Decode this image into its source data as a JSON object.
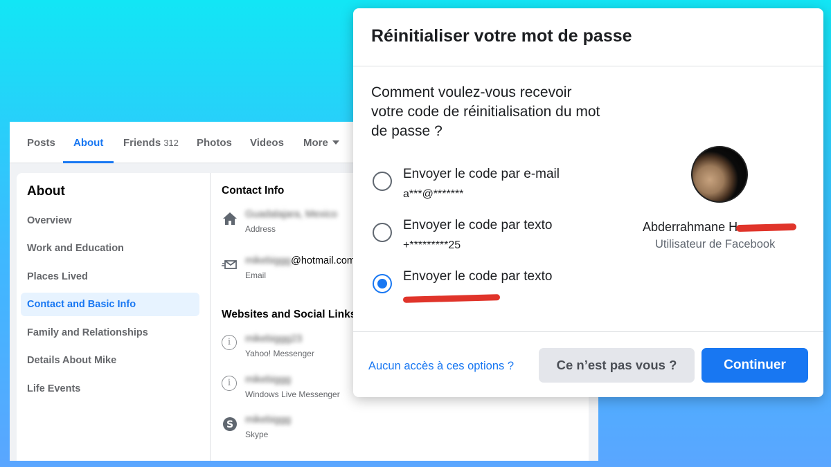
{
  "profile": {
    "tabs": [
      {
        "label": "Posts"
      },
      {
        "label": "About"
      },
      {
        "label": "Friends",
        "count": "312"
      },
      {
        "label": "Photos"
      },
      {
        "label": "Videos"
      },
      {
        "label": "More"
      }
    ],
    "active_tab": "About",
    "about_nav": {
      "title": "About",
      "items": [
        {
          "label": "Overview"
        },
        {
          "label": "Work and Education"
        },
        {
          "label": "Places Lived"
        },
        {
          "label": "Contact and Basic Info"
        },
        {
          "label": "Family and Relationships"
        },
        {
          "label": "Details About Mike"
        },
        {
          "label": "Life Events"
        }
      ],
      "active_item": "Contact and Basic Info"
    },
    "contact_info": {
      "title": "Contact Info",
      "address": {
        "label": "Address",
        "icon": "home-icon"
      },
      "email": {
        "value_suffix": "@hotmail.com",
        "label": "Email",
        "icon": "envelope-icon"
      }
    },
    "websites": {
      "title": "Websites and Social Links",
      "items": [
        {
          "label": "Yahoo! Messenger",
          "icon": "info-circle-icon"
        },
        {
          "label": "Windows Live Messenger",
          "icon": "info-circle-icon"
        },
        {
          "label": "Skype",
          "icon": "skype-icon"
        }
      ]
    }
  },
  "dialog": {
    "title": "Réinitialiser votre mot de passe",
    "question": "Comment voulez-vous recevoir votre code de réinitialisation du mot de passe ?",
    "options": [
      {
        "label": "Envoyer le code par e-mail",
        "detail": "a***@*******",
        "selected": false
      },
      {
        "label": "Envoyer le code par texto",
        "detail": "+*********25",
        "selected": false
      },
      {
        "label": "Envoyer le code par texto",
        "detail": "",
        "selected": true
      }
    ],
    "user": {
      "name": "Abderrahmane H",
      "subtitle": "Utilisateur de Facebook"
    },
    "no_access_link": "Aucun accès à ces options ?",
    "not_you_button": "Ce n’est pas vous ?",
    "continue_button": "Continuer",
    "colors": {
      "accent": "#1877f2",
      "redaction": "#e0342a"
    }
  }
}
